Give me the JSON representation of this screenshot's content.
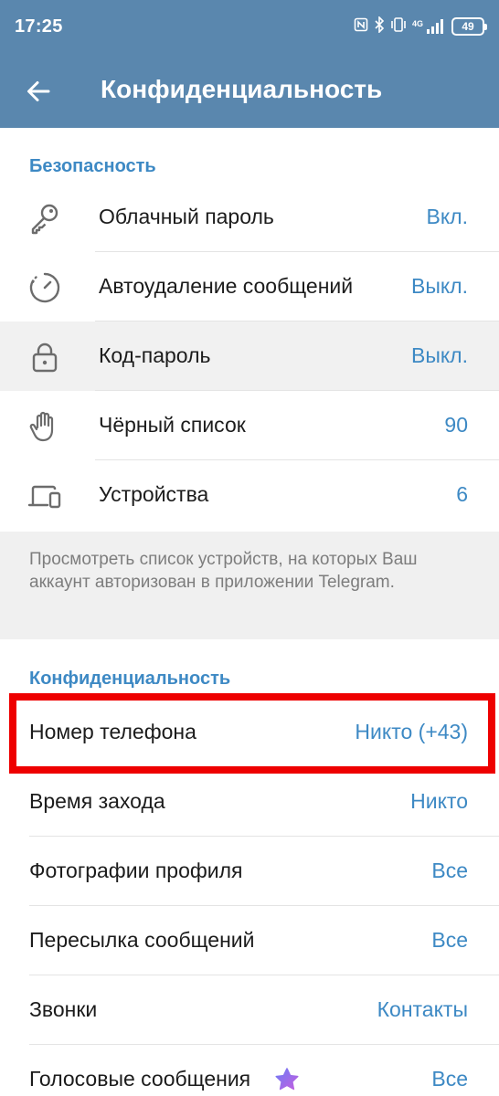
{
  "status_bar": {
    "time": "17:25",
    "network": "4G",
    "battery": "49"
  },
  "header": {
    "title": "Конфиденциальность"
  },
  "security": {
    "title": "Безопасность",
    "items": [
      {
        "label": "Облачный пароль",
        "value": "Вкл.",
        "icon": "key-icon"
      },
      {
        "label": "Автоудаление сообщений",
        "value": "Выкл.",
        "icon": "auto-delete-timer-icon"
      },
      {
        "label": "Код-пароль",
        "value": "Выкл.",
        "icon": "lock-icon"
      },
      {
        "label": "Чёрный список",
        "value": "90",
        "icon": "hand-block-icon"
      },
      {
        "label": "Устройства",
        "value": "6",
        "icon": "devices-icon"
      }
    ],
    "info": "Просмотреть список устройств, на которых Ваш аккаунт авторизован в приложении Telegram."
  },
  "privacy": {
    "title": "Конфиденциальность",
    "items": [
      {
        "label": "Номер телефона",
        "value": "Никто (+43)"
      },
      {
        "label": "Время захода",
        "value": "Никто"
      },
      {
        "label": "Фотографии профиля",
        "value": "Все"
      },
      {
        "label": "Пересылка сообщений",
        "value": "Все"
      },
      {
        "label": "Звонки",
        "value": "Контакты"
      },
      {
        "label": "Голосовые сообщения",
        "value": "Все"
      }
    ]
  },
  "colors": {
    "header_bg": "#5a87ae",
    "accent": "#3d89c4",
    "highlight": "#ee0000",
    "premium_star": "#a064e6"
  }
}
